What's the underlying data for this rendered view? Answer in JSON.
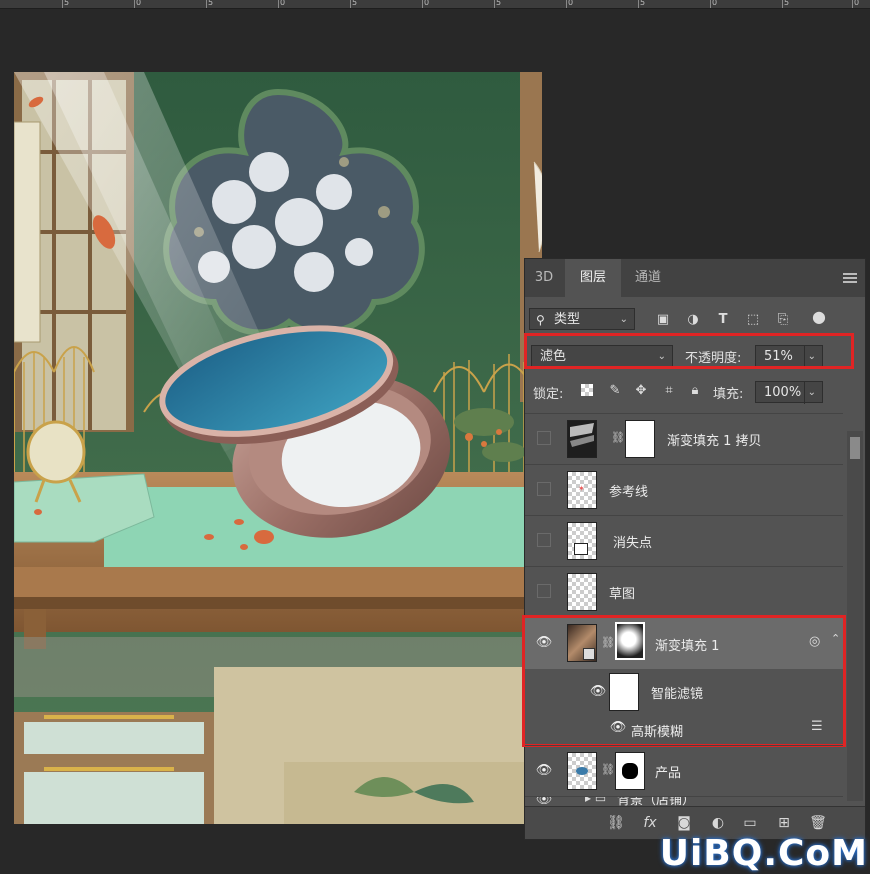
{
  "ruler": {
    "labels": [
      "5",
      "0",
      "5",
      "0",
      "5",
      "0",
      "5",
      "0",
      "5",
      "0",
      "5",
      "0"
    ]
  },
  "panel": {
    "tabs": [
      {
        "label": "3D",
        "active": false
      },
      {
        "label": "图层",
        "active": true
      },
      {
        "label": "通道",
        "active": false
      }
    ],
    "filter_kind": "类型",
    "blend_mode": "滤色",
    "opacity_label": "不透明度:",
    "opacity_value": "51%",
    "lock_label": "锁定:",
    "fill_label": "填充:",
    "fill_value": "100%",
    "layers": [
      {
        "name": "渐变填充 1 拷贝",
        "visible": false,
        "mask": true
      },
      {
        "name": "参考线",
        "visible": false,
        "mask": false
      },
      {
        "name": "消失点",
        "visible": false,
        "mask": false
      },
      {
        "name": "草图",
        "visible": false,
        "mask": false
      },
      {
        "name": "渐变填充 1",
        "visible": true,
        "mask": true,
        "selected": true
      },
      {
        "name": "智能滤镜",
        "visible": true
      },
      {
        "name": "高斯模糊",
        "visible": true
      },
      {
        "name": "产品",
        "visible": true,
        "mask": true
      },
      {
        "name": "背景（店铺）",
        "visible": true
      }
    ]
  },
  "icons": {
    "filter": "search-icon",
    "pixel": "image-icon",
    "adjust": "adjustment-icon",
    "type": "type-icon",
    "shape": "shape-icon",
    "smart": "smart-object-icon",
    "toggle": "filter-toggle-icon",
    "lock_transparent": "checker-icon",
    "lock_paint": "brush-icon",
    "lock_move": "move-icon",
    "lock_artboard": "artboard-icon",
    "lock_all": "lock-icon",
    "bottom": [
      "link-icon",
      "fx-icon",
      "mask-icon",
      "adjustment-layer-icon",
      "folder-icon",
      "new-layer-icon",
      "trash-icon"
    ]
  },
  "watermark": "UiBQ.CoM",
  "colors": {
    "panel_bg": "#535353",
    "highlight": "#e02424",
    "selected_row": "#6b6b6b"
  }
}
